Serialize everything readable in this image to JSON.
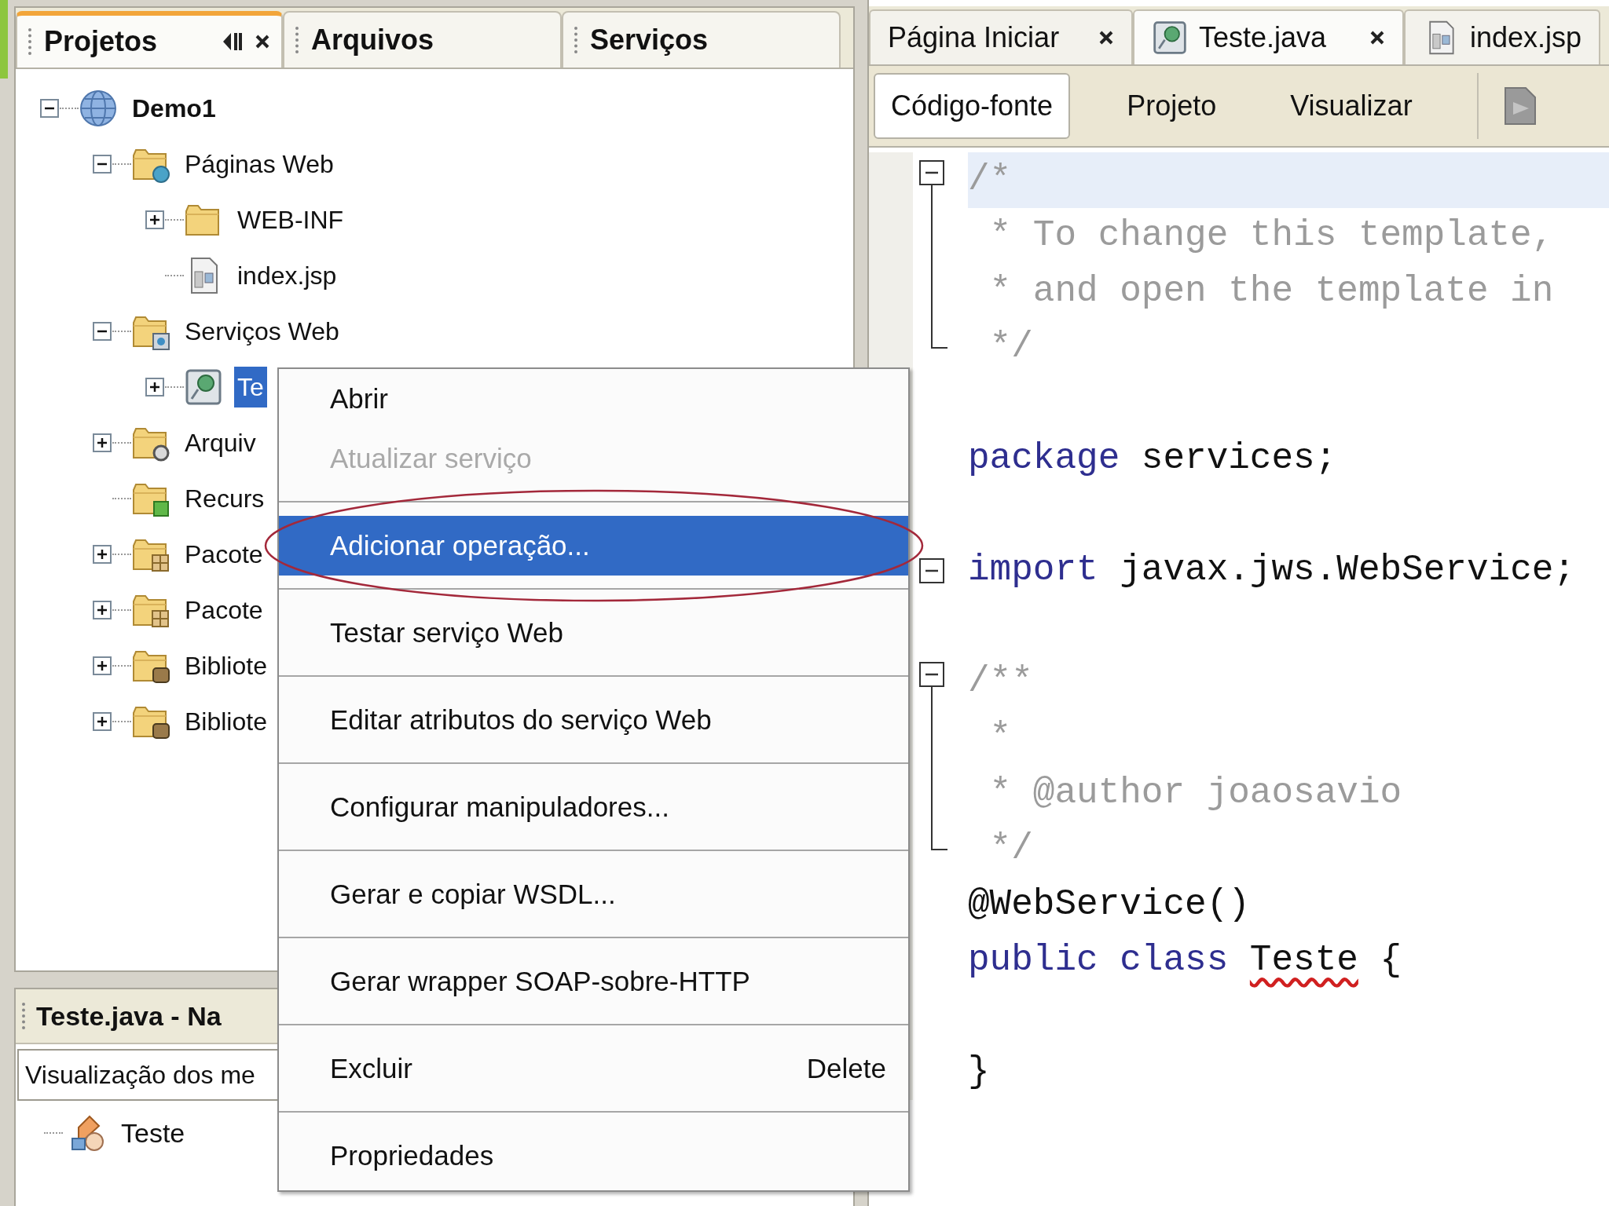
{
  "panel_tabs": [
    {
      "label": "Projetos",
      "selected": true,
      "closable": true
    },
    {
      "label": "Arquivos",
      "selected": false,
      "closable": false
    },
    {
      "label": "Serviços",
      "selected": false,
      "closable": false
    }
  ],
  "projects_tree": [
    {
      "label": "Demo1",
      "kind": "project",
      "expanded": true,
      "selected": false,
      "children": [
        {
          "label": "Páginas Web",
          "kind": "webfolder",
          "expanded": true,
          "selected": false,
          "children": [
            {
              "label": "WEB-INF",
              "kind": "folder",
              "expanded": false,
              "selected": false
            },
            {
              "label": "index.jsp",
              "kind": "jsp",
              "selected": false
            }
          ]
        },
        {
          "label": "Serviços Web",
          "kind": "servicefolder",
          "expanded": true,
          "selected": false,
          "children": [
            {
              "label": "Te",
              "kind": "service",
              "expanded": false,
              "selected": true
            }
          ]
        },
        {
          "label": "Arquiv",
          "kind": "configfolder",
          "expanded": false,
          "selected": false
        },
        {
          "label": "Recurs",
          "kind": "resourcefolder",
          "selected": false
        },
        {
          "label": "Pacote",
          "kind": "packagefolder",
          "expanded": false,
          "selected": false
        },
        {
          "label": "Pacote",
          "kind": "packagefolder",
          "expanded": false,
          "selected": false
        },
        {
          "label": "Bibliote",
          "kind": "libraryfolder",
          "expanded": false,
          "selected": false
        },
        {
          "label": "Bibliote",
          "kind": "libraryfolder",
          "expanded": false,
          "selected": false
        }
      ]
    }
  ],
  "navigator": {
    "title": "Teste.java - Na",
    "view_field": "Visualização dos me",
    "items": [
      {
        "label": "Teste",
        "kind": "class"
      }
    ]
  },
  "editor_tabs": [
    {
      "label": "Página Iniciar",
      "kind": "page",
      "closable": true,
      "selected": false
    },
    {
      "label": "Teste.java",
      "kind": "service",
      "closable": true,
      "selected": true
    },
    {
      "label": "index.jsp",
      "kind": "jsp",
      "closable": false,
      "selected": false
    }
  ],
  "view_buttons": [
    {
      "label": "Código-fonte",
      "selected": true
    },
    {
      "label": "Projeto",
      "selected": false
    },
    {
      "label": "Visualizar",
      "selected": false
    }
  ],
  "code_lines": [
    {
      "kind": "code",
      "fold_toggle": true,
      "fold_body": true,
      "current": true,
      "segments": [
        {
          "text": "/*",
          "kind": "comment"
        }
      ]
    },
    {
      "kind": "code",
      "fold_body": true,
      "current": false,
      "segments": [
        {
          "text": " * To change this template,",
          "kind": "comment"
        }
      ]
    },
    {
      "kind": "code",
      "fold_body": true,
      "current": false,
      "segments": [
        {
          "text": " * and open the template in",
          "kind": "comment"
        }
      ]
    },
    {
      "kind": "code",
      "fold_end": true,
      "current": false,
      "segments": [
        {
          "text": " */",
          "kind": "comment"
        }
      ]
    },
    {
      "kind": "blank"
    },
    {
      "kind": "code",
      "current": false,
      "segments": [
        {
          "text": "package",
          "kind": "keyword"
        },
        {
          "text": " services;",
          "kind": "plain"
        }
      ]
    },
    {
      "kind": "blank"
    },
    {
      "kind": "code",
      "fold_toggle": true,
      "current": false,
      "segments": [
        {
          "text": "import",
          "kind": "keyword"
        },
        {
          "text": " javax.jws.WebService;",
          "kind": "plain"
        }
      ]
    },
    {
      "kind": "blank"
    },
    {
      "kind": "code",
      "fold_toggle": true,
      "fold_body": true,
      "current": false,
      "segments": [
        {
          "text": "/**",
          "kind": "comment"
        }
      ]
    },
    {
      "kind": "code",
      "fold_body": true,
      "current": false,
      "segments": [
        {
          "text": " *",
          "kind": "comment"
        }
      ]
    },
    {
      "kind": "code",
      "fold_body": true,
      "current": false,
      "segments": [
        {
          "text": " * @author joaosavio",
          "kind": "comment"
        }
      ]
    },
    {
      "kind": "code",
      "fold_end": true,
      "current": false,
      "segments": [
        {
          "text": " */",
          "kind": "comment"
        }
      ]
    },
    {
      "kind": "code",
      "current": false,
      "segments": [
        {
          "text": "@WebService()",
          "kind": "plain"
        }
      ]
    },
    {
      "kind": "code",
      "current": false,
      "segments": [
        {
          "text": "public class ",
          "kind": "keyword"
        },
        {
          "text": "Teste",
          "kind": "error"
        },
        {
          "text": " {",
          "kind": "plain"
        }
      ]
    },
    {
      "kind": "blank"
    },
    {
      "kind": "code",
      "current": false,
      "segments": [
        {
          "text": "}",
          "kind": "plain"
        }
      ]
    }
  ],
  "context_menu": {
    "items": [
      {
        "label": "Abrir",
        "disabled": false,
        "selected": false,
        "separator_before": false,
        "circled": false
      },
      {
        "label": "Atualizar serviço",
        "disabled": true,
        "selected": false,
        "separator_before": false,
        "circled": false
      },
      {
        "label": "Adicionar operação...",
        "disabled": false,
        "selected": true,
        "separator_before": true,
        "circled": true
      },
      {
        "label": "Testar serviço Web",
        "disabled": false,
        "selected": false,
        "separator_before": true,
        "circled": false
      },
      {
        "label": "Editar atributos do serviço Web",
        "disabled": false,
        "selected": false,
        "separator_before": true,
        "circled": false
      },
      {
        "label": "Configurar manipuladores...",
        "disabled": false,
        "selected": false,
        "separator_before": true,
        "circled": false
      },
      {
        "label": "Gerar e copiar WSDL...",
        "disabled": false,
        "selected": false,
        "separator_before": true,
        "circled": false
      },
      {
        "label": "Gerar wrapper SOAP-sobre-HTTP",
        "disabled": false,
        "selected": false,
        "separator_before": true,
        "circled": false
      },
      {
        "label": "Excluir",
        "shortcut": "Delete",
        "disabled": false,
        "selected": false,
        "separator_before": true,
        "circled": false
      },
      {
        "label": "Propriedades",
        "disabled": false,
        "selected": false,
        "separator_before": true,
        "circled": false
      }
    ]
  }
}
